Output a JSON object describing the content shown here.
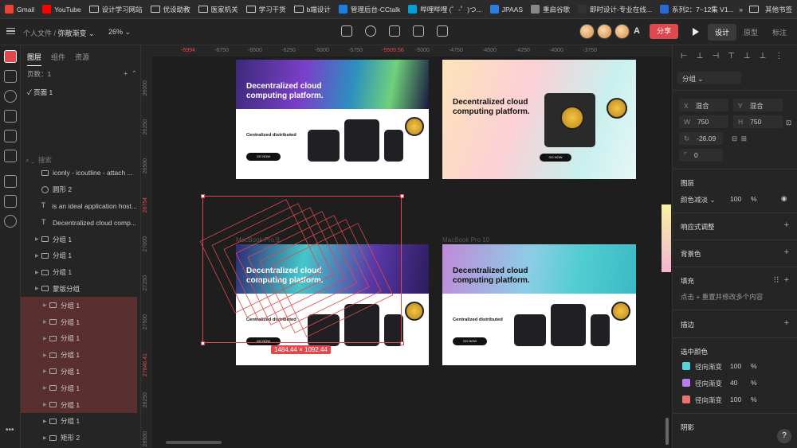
{
  "bookmarks": [
    {
      "label": "Gmail",
      "color": "#ea4335"
    },
    {
      "label": "YouTube",
      "color": "#ff0000"
    },
    {
      "label": "设计学习网站",
      "color": "folder"
    },
    {
      "label": "优设助教",
      "color": "folder"
    },
    {
      "label": "医家机关",
      "color": "folder"
    },
    {
      "label": "学习干货",
      "color": "folder"
    },
    {
      "label": "b端设计",
      "color": "folder"
    },
    {
      "label": "管理后台-CCtalk",
      "color": "#1a7fe0"
    },
    {
      "label": "哔哩哔哩 (゜-゜)つ...",
      "color": "#00a1d6"
    },
    {
      "label": "JPAAS",
      "color": "#2e7de0"
    },
    {
      "label": "重启谷歌",
      "color": "#888888"
    },
    {
      "label": "即时设计-专业在线...",
      "color": "#333333"
    },
    {
      "label": "系列2：7~12集 V1...",
      "color": "#2a6ad8"
    }
  ],
  "bookmarks_more": "»",
  "bookmarks_other": "其他书签",
  "toolbar": {
    "crumb_root": "个人文件 /",
    "crumb_file": "弥散渐变 ⌄",
    "zoom": "26% ⌄",
    "share": "分享",
    "mode_design": "设计",
    "mode_proto": "原型",
    "mode_annot": "标注"
  },
  "left": {
    "tabs": [
      "图层",
      "组件",
      "资源"
    ],
    "pages_label": "页数：1",
    "page1": "✓  页面 1",
    "search": "搜索",
    "layers": [
      {
        "label": "iconly - icoutline - attach ...",
        "type": "ico",
        "hl": false,
        "indent": 1
      },
      {
        "label": "圆形 2",
        "type": "c",
        "hl": false,
        "indent": 1
      },
      {
        "label": "is an ideal application host...",
        "type": "t",
        "hl": false,
        "indent": 1
      },
      {
        "label": "Decentralized cloud comp...",
        "type": "t",
        "hl": false,
        "indent": 1
      },
      {
        "label": "分组 1",
        "type": "ico",
        "hl": false,
        "indent": 1
      },
      {
        "label": "分组 1",
        "type": "ico",
        "hl": false,
        "indent": 1
      },
      {
        "label": "分组 1",
        "type": "ico",
        "hl": false,
        "indent": 1
      },
      {
        "label": "蒙版分组",
        "type": "ico",
        "hl": false,
        "indent": 1
      },
      {
        "label": "分组 1",
        "type": "ico",
        "hl": true,
        "indent": 2
      },
      {
        "label": "分组 1",
        "type": "ico",
        "hl": true,
        "indent": 2
      },
      {
        "label": "分组 1",
        "type": "ico",
        "hl": true,
        "indent": 2
      },
      {
        "label": "分组 1",
        "type": "ico",
        "hl": true,
        "indent": 2
      },
      {
        "label": "分组 1",
        "type": "ico",
        "hl": true,
        "indent": 2
      },
      {
        "label": "分组 1",
        "type": "ico",
        "hl": true,
        "indent": 2
      },
      {
        "label": "分组 1",
        "type": "ico",
        "hl": true,
        "indent": 2
      },
      {
        "label": "分组 1",
        "type": "ico",
        "hl": false,
        "indent": 2
      },
      {
        "label": "矩形 2",
        "type": "ico",
        "hl": false,
        "indent": 2
      }
    ]
  },
  "rulers": {
    "top": [
      "-6994",
      "-6750",
      "-6500",
      "-6250",
      "-6000",
      "-5750",
      "-5509.56",
      "-5000",
      "-4750",
      "-4500",
      "-4250",
      "-4000",
      "-3750"
    ],
    "left": [
      "26000",
      "26250",
      "26500",
      "26754",
      "27000",
      "27250",
      "27500",
      "27846.41",
      "28250",
      "28500"
    ]
  },
  "artboards": {
    "title": "Decentralized cloud computing platform.",
    "subtitle": "Centralized distributed",
    "cta": "GO NOW",
    "label9": "MacBook Pro 9",
    "label10": "MacBook Pro 10"
  },
  "selection": {
    "size": "1484.44 × 1092.44"
  },
  "right": {
    "group": "分组 ⌄",
    "x_label": "X",
    "x_val": "混合",
    "y_label": "Y",
    "y_val": "混合",
    "w_label": "W",
    "w_val": "750",
    "h_label": "H",
    "h_val": "750",
    "rotation": "-26.09",
    "radius": "0",
    "layer_title": "图层",
    "blend": "颜色减淡 ⌄",
    "opacity": "100",
    "pct": "%",
    "responsive": "响应式调整",
    "bg": "背景色",
    "fill": "填充",
    "fill_hint": "点击  +  重置并修改多个内容",
    "stroke": "描边",
    "sel_colors": "选中颜色",
    "swatches": [
      {
        "label": "径向渐变",
        "val": "100",
        "color": "#5ad0d8"
      },
      {
        "label": "径向渐变",
        "val": "40",
        "color": "#b77cf0"
      },
      {
        "label": "径向渐变",
        "val": "100",
        "color": "#f07070"
      }
    ],
    "shadow": "阴影"
  },
  "help": "?"
}
